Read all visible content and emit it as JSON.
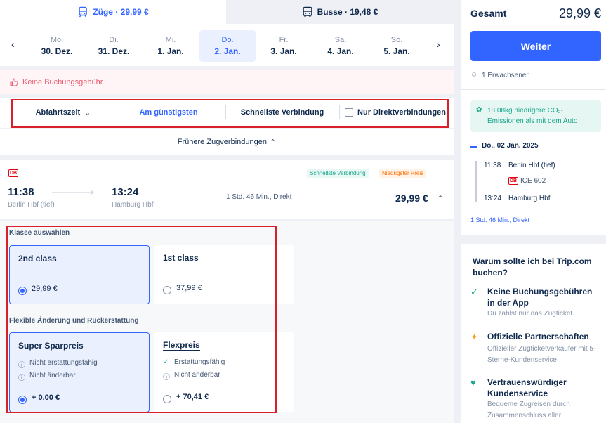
{
  "tabs": {
    "trains_label": "Züge · 29,99 €",
    "buses_label": "Busse · 19,48 €"
  },
  "dates": [
    {
      "dow": "Mo.",
      "day": "30. Dez."
    },
    {
      "dow": "Di.",
      "day": "31. Dez."
    },
    {
      "dow": "Mi.",
      "day": "1. Jan."
    },
    {
      "dow": "Do.",
      "day": "2. Jan."
    },
    {
      "dow": "Fr.",
      "day": "3. Jan."
    },
    {
      "dow": "Sa.",
      "day": "4. Jan."
    },
    {
      "dow": "So.",
      "day": "5. Jan."
    }
  ],
  "banner": {
    "text": "Keine Buchungsgebühr"
  },
  "sort": {
    "departure": "Abfahrtszeit",
    "cheapest": "Am günstigsten",
    "fastest": "Schnellste Verbindung",
    "direct": "Nur Direktverbindungen"
  },
  "earlier": "Frühere Zugverbindungen",
  "train": {
    "operator_badge": "DB",
    "tag_fastest": "Schnellste Verbindung",
    "tag_cheapest": "Niedrigster Preis",
    "dep_time": "11:38",
    "dep_station": "Berlin Hbf (tief)",
    "arr_time": "13:24",
    "arr_station": "Hamburg Hbf",
    "duration": "1 Std. 46 Min., Direkt",
    "price": "29,99 €"
  },
  "class_section": {
    "title": "Klasse auswählen",
    "second": {
      "name": "2nd class",
      "price": "29,99 €"
    },
    "first": {
      "name": "1st class",
      "price": "37,99 €"
    }
  },
  "fare_section": {
    "title": "Flexible Änderung und Rückerstattung",
    "super": {
      "name": "Super Sparpreis",
      "l1": "Nicht erstattungsfähig",
      "l2": "Nicht änderbar",
      "price": "+ 0,00 €"
    },
    "flex": {
      "name": "Flexpreis",
      "l1": "Erstattungsfähig",
      "l2": "Nicht änderbar",
      "price": "+ 70,41 €"
    }
  },
  "summary": {
    "total_label": "Gesamt",
    "total_value": "29,99 €",
    "continue": "Weiter",
    "passengers": "1 Erwachsener",
    "eco": "18.08kg niedrigere CO₂-Emissionen als mit dem Auto",
    "date": "Do., 02 Jan. 2025",
    "dep_time": "11:38",
    "dep_station": "Berlin Hbf (tief)",
    "train_no": "ICE 602",
    "arr_time": "13:24",
    "arr_station": "Hamburg Hbf",
    "duration": "1 Std. 46 Min., Direkt"
  },
  "why": {
    "title": "Warum sollte ich bei Trip.com buchen?",
    "items": [
      {
        "title": "Keine Buchungsgebühren in der App",
        "sub": "Du zahlst nur das Zugticket."
      },
      {
        "title": "Offizielle Partnerschaften",
        "sub": "Offizieller Zugticketverkäufer mit 5-Sterne-Kundenservice"
      },
      {
        "title": "Vertrauenswürdiger Kundenservice",
        "sub": "Bequeme Zugreisen durch Zusammenschluss aller"
      }
    ]
  },
  "colors": {
    "accent": "#3264ff",
    "highlight": "#d9202a",
    "eco_bg": "#e6f7f3"
  }
}
